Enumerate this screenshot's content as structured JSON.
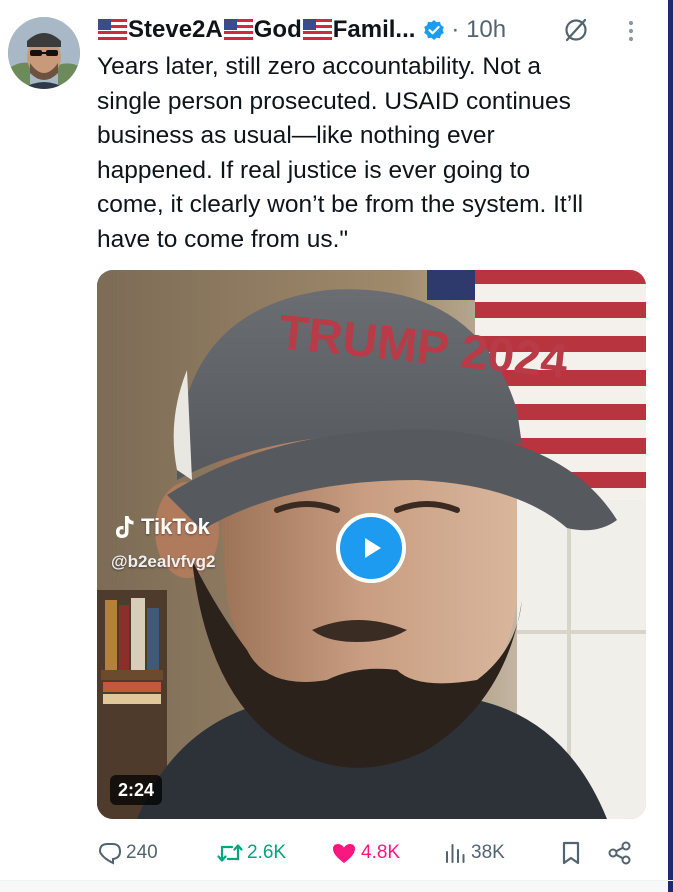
{
  "post": {
    "author_name": "Steve2A",
    "author_name_part2": "God",
    "author_name_part3": "Famil...",
    "time_meta": "· 10h",
    "text": "Years later, still zero accountability. Not a\nsingle person prosecuted. USAID continues\nbusiness as usual—like nothing ever\nhappened. If real justice is ever going to\ncome, it clearly won’t be from the system. It’ll\nhave to come from us.\""
  },
  "media": {
    "watermark_brand": "TikTok",
    "watermark_handle": "@b2ealvfvg2",
    "duration": "2:24",
    "hat_text": "TRUMP 2024"
  },
  "actions": {
    "replies": "240",
    "reposts": "2.6K",
    "likes": "4.8K",
    "views": "38K"
  },
  "colors": {
    "text_primary": "#0f1419",
    "text_secondary": "#536471",
    "verified_blue": "#1d9bf0",
    "repost_green": "#00a67c",
    "like_pink": "#f91880"
  },
  "icons": {
    "reply": "speech-bubble-icon",
    "repost": "repost-arrows-icon",
    "like": "heart-filled-icon",
    "views": "bar-chart-icon",
    "bookmark": "bookmark-icon",
    "share": "share-icon",
    "grok": "grok-slash-circle-icon",
    "more": "vertical-ellipsis-icon",
    "verified": "verified-badge-icon",
    "flag": "us-flag-icon",
    "play": "play-icon"
  }
}
